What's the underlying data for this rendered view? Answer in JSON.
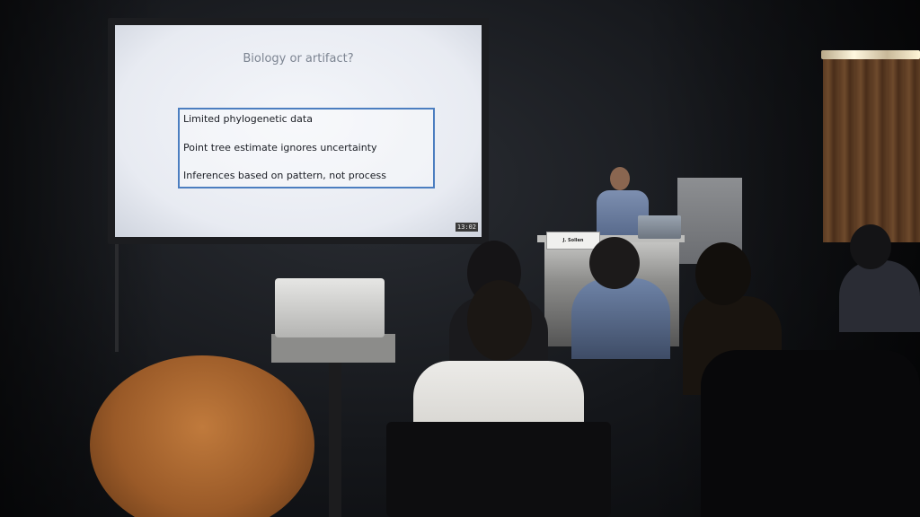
{
  "slide": {
    "title": "Biology or artifact?",
    "bullets": [
      "Limited phylogenetic data",
      "Point tree estimate ignores uncertainty",
      "Inferences based on pattern, not process"
    ],
    "timer": "13:02"
  },
  "podium": {
    "name_card": "J. Sollen"
  },
  "colors": {
    "slide_box_border": "#4c7ec0",
    "slide_title": "#7d8592",
    "room_dark": "#0a0a0c"
  }
}
